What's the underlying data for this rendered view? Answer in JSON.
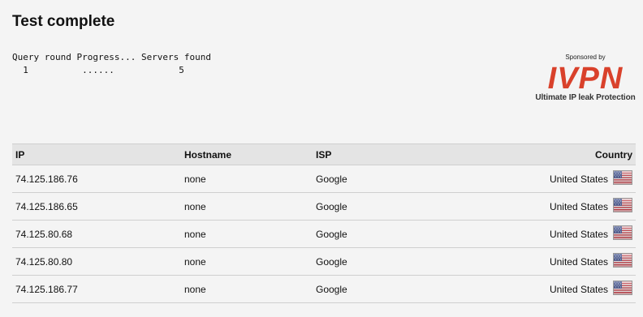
{
  "title": "Test complete",
  "progress": {
    "header": "Query round Progress... Servers found",
    "row": "  1          ......            5"
  },
  "sponsor": {
    "caption": "Sponsored by",
    "logo_text": "IVPN",
    "tagline": "Ultimate IP leak Protection",
    "logo_color": "#d9412b"
  },
  "table": {
    "headers": {
      "ip": "IP",
      "hostname": "Hostname",
      "isp": "ISP",
      "country": "Country"
    },
    "rows": [
      {
        "ip": "74.125.186.76",
        "hostname": "none",
        "isp": "Google",
        "country": "United States",
        "flag": "us-flag-icon"
      },
      {
        "ip": "74.125.186.65",
        "hostname": "none",
        "isp": "Google",
        "country": "United States",
        "flag": "us-flag-icon"
      },
      {
        "ip": "74.125.80.68",
        "hostname": "none",
        "isp": "Google",
        "country": "United States",
        "flag": "us-flag-icon"
      },
      {
        "ip": "74.125.80.80",
        "hostname": "none",
        "isp": "Google",
        "country": "United States",
        "flag": "us-flag-icon"
      },
      {
        "ip": "74.125.186.77",
        "hostname": "none",
        "isp": "Google",
        "country": "United States",
        "flag": "us-flag-icon"
      }
    ]
  }
}
